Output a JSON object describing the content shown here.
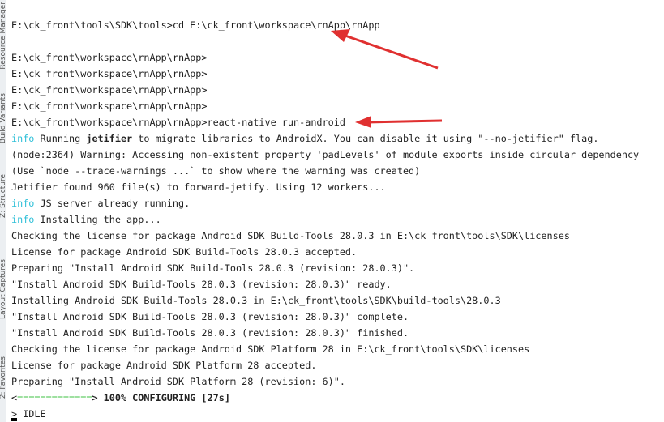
{
  "sidebar": {
    "tabs": [
      "Resource Manager",
      "Build Variants",
      "Z: Structure",
      "Layout Captures",
      "2: Favorites"
    ]
  },
  "terminal": {
    "lines": [
      {
        "text": "E:\\ck_front\\tools\\SDK\\tools>cd E:\\ck_front\\workspace\\rnApp\\rnApp"
      },
      {
        "text": ""
      },
      {
        "text": "E:\\ck_front\\workspace\\rnApp\\rnApp>"
      },
      {
        "text": "E:\\ck_front\\workspace\\rnApp\\rnApp>"
      },
      {
        "text": "E:\\ck_front\\workspace\\rnApp\\rnApp>"
      },
      {
        "text": "E:\\ck_front\\workspace\\rnApp\\rnApp>"
      },
      {
        "text": "E:\\ck_front\\workspace\\rnApp\\rnApp>react-native run-android"
      },
      {
        "prefix": "info",
        "text": " Running ",
        "bold": "jetifier",
        "rest": " to migrate libraries to AndroidX. You can disable it using \"--no-jetifier\" flag."
      },
      {
        "text": "(node:2364) Warning: Accessing non-existent property 'padLevels' of module exports inside circular dependency"
      },
      {
        "text": "(Use `node --trace-warnings ...` to show where the warning was created)"
      },
      {
        "text": "Jetifier found 960 file(s) to forward-jetify. Using 12 workers..."
      },
      {
        "prefix": "info",
        "text": " JS server already running."
      },
      {
        "prefix": "info",
        "text": " Installing the app..."
      },
      {
        "text": "Checking the license for package Android SDK Build-Tools 28.0.3 in E:\\ck_front\\tools\\SDK\\licenses"
      },
      {
        "text": "License for package Android SDK Build-Tools 28.0.3 accepted."
      },
      {
        "text": "Preparing \"Install Android SDK Build-Tools 28.0.3 (revision: 28.0.3)\"."
      },
      {
        "text": "\"Install Android SDK Build-Tools 28.0.3 (revision: 28.0.3)\" ready."
      },
      {
        "text": "Installing Android SDK Build-Tools 28.0.3 in E:\\ck_front\\tools\\SDK\\build-tools\\28.0.3"
      },
      {
        "text": "\"Install Android SDK Build-Tools 28.0.3 (revision: 28.0.3)\" complete."
      },
      {
        "text": "\"Install Android SDK Build-Tools 28.0.3 (revision: 28.0.3)\" finished."
      },
      {
        "text": "Checking the license for package Android SDK Platform 28 in E:\\ck_front\\tools\\SDK\\licenses"
      },
      {
        "text": "License for package Android SDK Platform 28 accepted."
      },
      {
        "text": "Preparing \"Install Android SDK Platform 28 (revision: 6)\"."
      }
    ],
    "progress": {
      "open": "<",
      "bar": "=============",
      "close": ">",
      "status": " 100% CONFIGURING [27s]",
      "percent": 100
    },
    "idle": "> IDLE"
  },
  "colors": {
    "info": "#2fc0d8",
    "arrow": "#e03030",
    "progress": "#3cc040"
  }
}
